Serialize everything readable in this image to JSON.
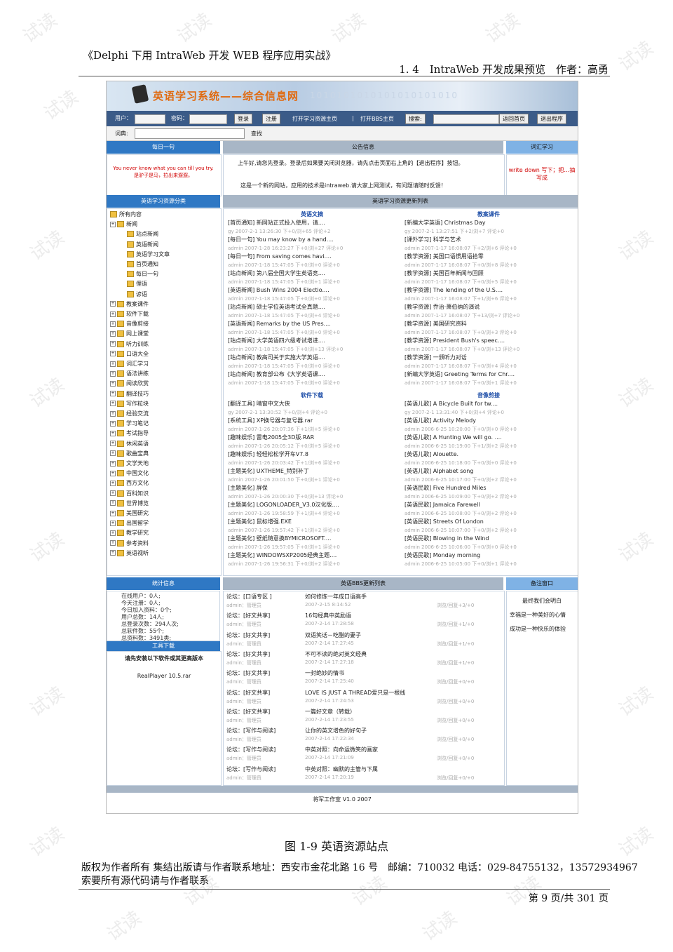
{
  "doc_header": {
    "title": "《Delphi 下用 IntraWeb 开发 WEB 程序应用实战》",
    "section": "1. 4　IntraWeb 开发成果预览　作者：高勇"
  },
  "watermark": "试读",
  "site": {
    "title": "英语学习系统——综合信息网",
    "binary": "1010101010101010101010",
    "login": {
      "user_label": "用户：",
      "pass_label": "密码：",
      "login_btn": "登录",
      "register_btn": "注册",
      "link_learning": "打开学习资源主页",
      "separator": "|",
      "link_bbs": "打开BBS主页",
      "search_btn": "搜索:",
      "home_btn": "返回首页",
      "exit_btn": "退出程序"
    },
    "dict": {
      "label": "词典:",
      "go": "查找"
    },
    "daily": {
      "header": "每日一句",
      "en": "You never know what you can till you try.",
      "zh": "是驴子是马，拉出来遛遛。"
    },
    "notice": {
      "header": "公告信息",
      "line1": "上午好,请您先登录。登录后如果要关闭浏览器，请先点击页面右上角的【退出程序】按钮。",
      "line2": "这是一个新的网站，应用的技术是intraweb.请大家上网测试，有问题请随时反馈！"
    },
    "vocab": {
      "header": "词汇学习",
      "text": "write down 写下；把…抽写成"
    },
    "category": {
      "header": "英语学习资源分类",
      "root": "所有内容",
      "news": "新闻",
      "news_children": [
        "站点新闻",
        "英语新闻",
        "英语学习文章",
        "首页通知",
        "每日一句",
        "俚语",
        "谚语"
      ],
      "folders": [
        "教案课件",
        "软件下载",
        "音像剪接",
        "网上课堂",
        "听力训练",
        "口语大全",
        "词汇学习",
        "语法讲练",
        "阅读欣赏",
        "翻译技巧",
        "写作粒块",
        "经验交流",
        "学习笔记",
        "考试指导",
        "休闲英语",
        "歌曲宝典",
        "文学天地",
        "中国文化",
        "西方文化",
        "百科知识",
        "世界博览",
        "美国研究",
        "出国留学",
        "教学研究",
        "参考资料",
        "英语视听"
      ]
    },
    "updates": {
      "header": "英语学习资源更新列表",
      "sections": [
        {
          "title": "英语文摘",
          "items": [
            {
              "t": "[首页通知] 新网站正式投入使用，请....",
              "m": "gy 2007-2-1 13:26:30 下+0/浏+65 评论+2"
            },
            {
              "t": "[每日一句] You may know by a hand....",
              "m": "admin 2007-1-28 16:23:27 下+0/浏+27 评论+0"
            },
            {
              "t": "[每日一句] From saving comes havi....",
              "m": "admin 2007-1-18 15:47:05 下+0/浏+0 评论+0"
            },
            {
              "t": "[站点新闻] 第八届全国大学生英语竞....",
              "m": "admin 2007-1-18 15:47:05 下+0/浏+1 评论+0"
            },
            {
              "t": "[英语新闻] Bush Wins 2004 Electio....",
              "m": "admin 2007-1-18 15:47:05 下+0/浏+0 评论+0"
            },
            {
              "t": "[站点新闻] 硕士学位英语考试全真题....",
              "m": "admin 2007-1-18 15:47:05 下+0/浏+4 评论+0"
            },
            {
              "t": "[英语新闻] Remarks by the US Pres....",
              "m": "admin 2007-1-18 15:47:05 下+0/浏+0 评论+0"
            },
            {
              "t": "[站点新闻] 大学英语四六级考试增进....",
              "m": "admin 2007-1-18 15:47:05 下+0/浏+13 评论+0"
            },
            {
              "t": "[站点新闻] 教高司关于实施大学英语....",
              "m": "admin 2007-1-18 15:47:05 下+0/浏+0 评论+0"
            },
            {
              "t": "[站点新闻] 教育部公布《大学英语课....",
              "m": "admin 2007-1-18 15:47:05 下+0/浏+0 评论+0"
            }
          ]
        },
        {
          "title": "教案课件",
          "items": [
            {
              "t": "[新编大学英语] Christmas Day",
              "m": "gy 2007-2-1 13:27:51 下+2/浏+7 评论+0"
            },
            {
              "t": "[课外学习] 科学与艺术",
              "m": "admin 2007-1-17 16:08:07 下+2/浏+6 评论+0"
            },
            {
              "t": "[教学资源] 美国口语惯用语拾零",
              "m": "admin 2007-1-17 16:08:07 下+0/浏+8 评论+0"
            },
            {
              "t": "[教学资源] 美国百年新闻与回顾",
              "m": "admin 2007-1-17 16:08:07 下+0/浏+5 评论+0"
            },
            {
              "t": "[教学资源] The lending of the U.S....",
              "m": "admin 2007-1-17 16:08:07 下+1/浏+6 评论+0"
            },
            {
              "t": "[教学资源] 乔治·萧伯纳的演说",
              "m": "admin 2007-1-17 16:08:07 下+13/浏+7 评论+0"
            },
            {
              "t": "[教学资源] 美国研究资料",
              "m": "admin 2007-1-17 16:08:07 下+0/浏+3 评论+0"
            },
            {
              "t": "[教学资源] President Bush's speec....",
              "m": "admin 2007-1-17 16:08:07 下+0/浏+13 评论+0"
            },
            {
              "t": "[教学资源] 一颁听力对话",
              "m": "admin 2007-1-17 16:08:07 下+0/浏+4 评论+0"
            },
            {
              "t": "[新编大学英语] Greeting Terms for Chr....",
              "m": "admin 2007-1-17 16:08:07 下+0/浏+1 评论+0"
            }
          ]
        },
        {
          "title": "软件下载",
          "items": [
            {
              "t": "[翻译工具] 晴窗中文大侠",
              "m": "gy 2007-2-1 13:30:52 下+0/浏+4 评论+0"
            },
            {
              "t": "[系统工具] XP换号器与复号器.rar",
              "m": "admin 2007-1-26 20:07:36 下+1/浏+5 评论+0"
            },
            {
              "t": "[趣味娱乐] 雷电2005全3D版.RAR",
              "m": "admin 2007-1-26 20:05:12 下+0/浏+5 评论+0"
            },
            {
              "t": "[趣味娱乐] 轻轻松松学开车V7.8",
              "m": "admin 2007-1-26 20:03:42 下+1/浏+6 评论+0"
            },
            {
              "t": "[主题美化] UXTHEME_特别补丁",
              "m": "admin 2007-1-26 20:01:50 下+0/浏+1 评论+0"
            },
            {
              "t": "[主题美化] 屏保",
              "m": "admin 2007-1-26 20:00:30 下+0/浏+13 评论+0"
            },
            {
              "t": "[主题美化] LOGONLOADER_V3.0汉化版....",
              "m": "admin 2007-1-26 19:58:59 下+1/浏+4 评论+0"
            },
            {
              "t": "[主题美化] 鼠标增强.EXE",
              "m": "admin 2007-1-26 19:57:42 下+1/浏+2 评论+0"
            },
            {
              "t": "[主题美化] 壁纸随意换BYMICROSOFT....",
              "m": "admin 2007-1-26 19:57:05 下+0/浏+1 评论+0"
            },
            {
              "t": "[主题美化] WINDOWSXP2005经典主题....",
              "m": "admin 2007-1-26 19:56:31 下+0/浏+2 评论+0"
            }
          ]
        },
        {
          "title": "音像剪接",
          "items": [
            {
              "t": "[英语儿歌] A Bicycle Built for tw....",
              "m": "gy 2007-2-1 13:31:40 下+0/浏+4 评论+0"
            },
            {
              "t": "[英语儿歌] Activity Melody",
              "m": "admin 2006-6-25 10:20:00 下+0/浏+0 评论+0"
            },
            {
              "t": "[英语儿歌] A Hunting We will go. ....",
              "m": "admin 2006-6-25 10:19:00 下+1/浏+2 评论+0"
            },
            {
              "t": "[英语儿歌] Alouette.",
              "m": "admin 2006-6-25 10:18:00 下+0/浏+0 评论+0"
            },
            {
              "t": "[英语儿歌] Alphabet song",
              "m": "admin 2006-6-25 10:17:00 下+0/浏+2 评论+0"
            },
            {
              "t": "[英语民歌] Five Hundred Miles",
              "m": "admin 2006-6-25 10:09:00 下+0/浏+2 评论+0"
            },
            {
              "t": "[英语民歌] Jamaica Farewell",
              "m": "admin 2006-6-25 10:08:00 下+0/浏+2 评论+0"
            },
            {
              "t": "[英语民歌] Streets Of London",
              "m": "admin 2006-6-25 10:07:00 下+0/浏+2 评论+0"
            },
            {
              "t": "[英语民歌] Blowing in the Wind",
              "m": "admin 2006-6-25 10:06:00 下+0/浏+0 评论+0"
            },
            {
              "t": "[英语民歌] Monday morning",
              "m": "admin 2006-6-25 10:05:00 下+0/浏+1 评论+0"
            }
          ]
        }
      ]
    },
    "stats": {
      "header": "统计信息",
      "lines": [
        "在线用户：0人;",
        "今天注册：0人;",
        "今日加入资料：0个;",
        "用户总数：14人;",
        "总登录次数：294人次;",
        "总软件数：55个;",
        "总资料数：3491类;"
      ]
    },
    "tools": {
      "header": "工具下载",
      "note": "请先安装以下软件或其更高版本",
      "item": "RealPlayer 10.5.rar"
    },
    "bbs": {
      "header": "英语BBS更新列表",
      "rows": [
        {
          "forum": "论坛：[口语专区 ]",
          "user": "admin：管理员",
          "title": "如何修炼一年成口语高手",
          "time": "2007-2-15 8:14:52",
          "stat": "浏览/回复+3/+0"
        },
        {
          "forum": "论坛：[好文共享]",
          "user": "admin：管理员",
          "title": "16句经典中英励语",
          "time": "2007-2-14 17:28:58",
          "stat": "浏览/回复+1/+0"
        },
        {
          "forum": "论坛：[好文共享]",
          "user": "admin：管理员",
          "title": "双语笑话－吃醋的妻子",
          "time": "2007-2-14 17:27:45",
          "stat": "浏览/回复+1/+0"
        },
        {
          "forum": "论坛：[好文共享]",
          "user": "admin：管理员",
          "title": "不可不读的绝对英文经典",
          "time": "2007-2-14 17:27:18",
          "stat": "浏览/回复+1/+0"
        },
        {
          "forum": "论坛：[好文共享]",
          "user": "admin：管理员",
          "title": "一封绝妙的情书",
          "time": "2007-2-14 17:25:40",
          "stat": "浏览/回复+0/+0"
        },
        {
          "forum": "论坛：[好文共享]",
          "user": "admin：管理员",
          "title": "LOVE IS JUST A THREAD爱只是一根线",
          "time": "2007-2-14 17:24:53",
          "stat": "浏览/回复+0/+0"
        },
        {
          "forum": "论坛：[好文共享]",
          "user": "admin：管理员",
          "title": "一篇好文章（转载）",
          "time": "2007-2-14 17:23:55",
          "stat": "浏览/回复+0/+0"
        },
        {
          "forum": "论坛：[写作与阅读]",
          "user": "admin：管理员",
          "title": "让你的英文增色的好句子",
          "time": "2007-2-14 17:22:34",
          "stat": "浏览/回复+0/+0"
        },
        {
          "forum": "论坛：[写作与阅读]",
          "user": "admin：管理员",
          "title": "中英对照：向命运微笑的画家",
          "time": "2007-2-14 17:21:09",
          "stat": "浏览/回复+0/+0"
        },
        {
          "forum": "论坛：[写作与阅读]",
          "user": "admin：管理员",
          "title": "中英对照：幽默的主管与下属",
          "time": "2007-2-14 17:20:19",
          "stat": "浏览/回复+0/+0"
        }
      ]
    },
    "memo": {
      "header": "备注窗口",
      "lines": [
        "最终我们会明白",
        "幸福是一种美好的心情",
        "成功是一种快乐的体验"
      ]
    },
    "credit": "将军工作室 V1.0 2007"
  },
  "caption": "图 1-9 英语资源站点",
  "copyright": {
    "line1": "版权为作者所有 集结出版请与作者联系地址：西安市金花北路 16 号　邮编：710032 电话：029-84755132，13572934967",
    "line2": "索要所有源代码请与作者联系"
  },
  "page_no": "第 9 页/共 301 页"
}
